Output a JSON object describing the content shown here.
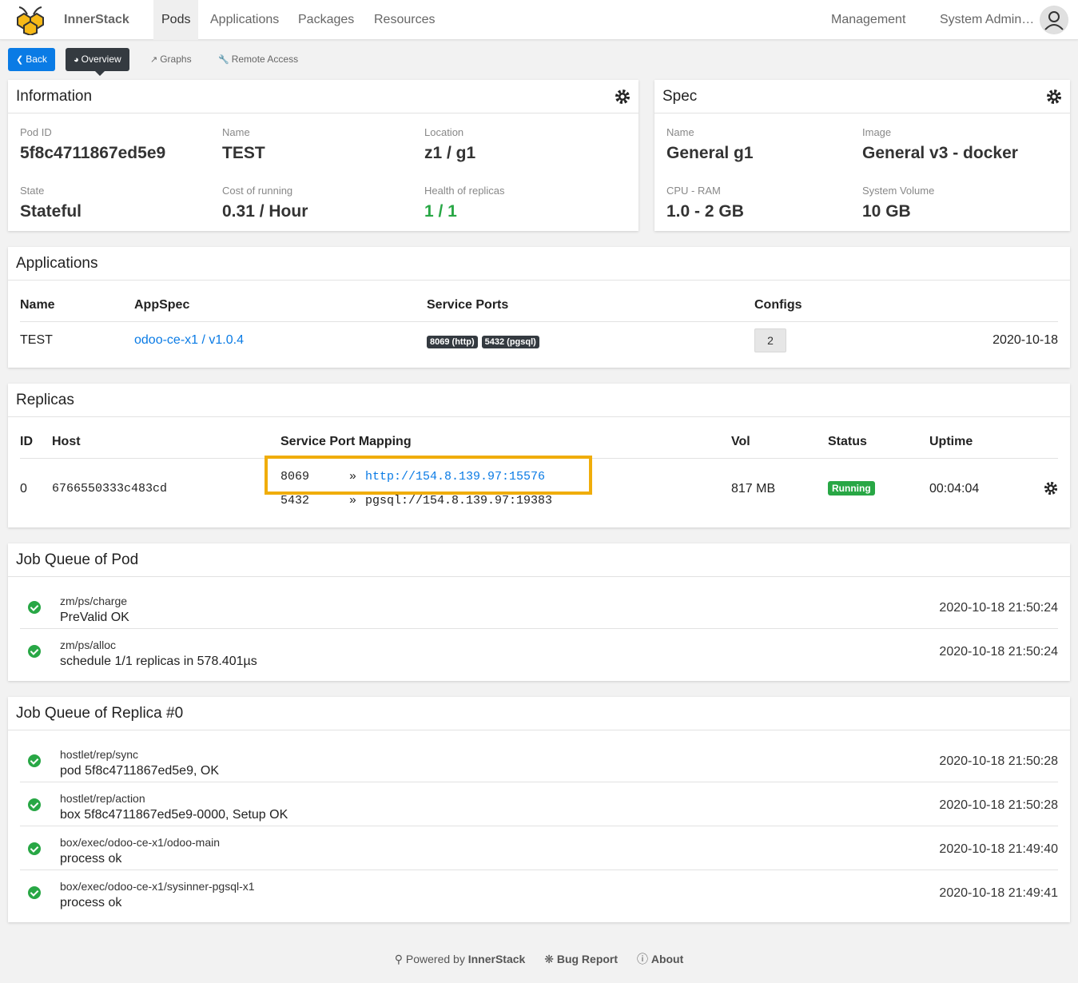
{
  "nav": {
    "brand": "InnerStack",
    "items": [
      "Pods",
      "Applications",
      "Packages",
      "Resources"
    ],
    "right": [
      "Management",
      "System Admin…"
    ]
  },
  "toolbar": {
    "back": "Back",
    "overview": "Overview",
    "graphs": "Graphs",
    "remote": "Remote Access"
  },
  "information": {
    "title": "Information",
    "fields": [
      {
        "label": "Pod ID",
        "value": "5f8c4711867ed5e9"
      },
      {
        "label": "Name",
        "value": "TEST"
      },
      {
        "label": "Location",
        "value": "z1 / g1"
      },
      {
        "label": "State",
        "value": "Stateful"
      },
      {
        "label": "Cost of running",
        "value": "0.31 / Hour"
      },
      {
        "label": "Health of replicas",
        "value": "1 / 1"
      }
    ]
  },
  "spec": {
    "title": "Spec",
    "fields": [
      {
        "label": "Name",
        "value": "General g1"
      },
      {
        "label": "Image",
        "value": "General v3 - docker"
      },
      {
        "label": "CPU - RAM",
        "value": "1.0 - 2 GB"
      },
      {
        "label": "System Volume",
        "value": "10 GB"
      }
    ]
  },
  "applications": {
    "title": "Applications",
    "headers": [
      "Name",
      "AppSpec",
      "Service Ports",
      "Configs"
    ],
    "row": {
      "name": "TEST",
      "appspec": "odoo-ce-x1 / v1.0.4",
      "ports": [
        "8069 (http)",
        "5432 (pgsql)"
      ],
      "configs": "2",
      "date": "2020-10-18"
    }
  },
  "replicas": {
    "title": "Replicas",
    "headers": [
      "ID",
      "Host",
      "Service Port Mapping",
      "Vol",
      "Status",
      "Uptime"
    ],
    "row": {
      "id": "0",
      "host": "6766550333c483cd",
      "mappings": [
        {
          "port": "8069",
          "arrow": "»",
          "url": "http://154.8.139.97:15576"
        },
        {
          "port": "5432",
          "arrow": "»",
          "url": "pgsql://154.8.139.97:19383"
        }
      ],
      "vol": "817 MB",
      "status": "Running",
      "uptime": "00:04:04"
    }
  },
  "pod_jobs": {
    "title": "Job Queue of Pod",
    "items": [
      {
        "name": "zm/ps/charge",
        "msg": "PreValid OK",
        "time": "2020-10-18 21:50:24"
      },
      {
        "name": "zm/ps/alloc",
        "msg": "schedule 1/1 replicas in 578.401µs",
        "time": "2020-10-18 21:50:24"
      }
    ]
  },
  "replica_jobs": {
    "title": "Job Queue of Replica #0",
    "items": [
      {
        "name": "hostlet/rep/sync",
        "msg": "pod 5f8c4711867ed5e9, OK",
        "time": "2020-10-18 21:50:28"
      },
      {
        "name": "hostlet/rep/action",
        "msg": "box 5f8c4711867ed5e9-0000, Setup OK",
        "time": "2020-10-18 21:50:28"
      },
      {
        "name": "box/exec/odoo-ce-x1/odoo-main",
        "msg": "process ok",
        "time": "2020-10-18 21:49:40"
      },
      {
        "name": "box/exec/odoo-ce-x1/sysinner-pgsql-x1",
        "msg": "process ok",
        "time": "2020-10-18 21:49:41"
      }
    ]
  },
  "footer": {
    "powered": "Powered by",
    "brand": "InnerStack",
    "bug": "Bug Report",
    "about": "About"
  },
  "colors": {
    "accent": "#0a7be5",
    "success": "#28a745",
    "dark": "#343a40",
    "highlight": "#f0ad0a"
  }
}
